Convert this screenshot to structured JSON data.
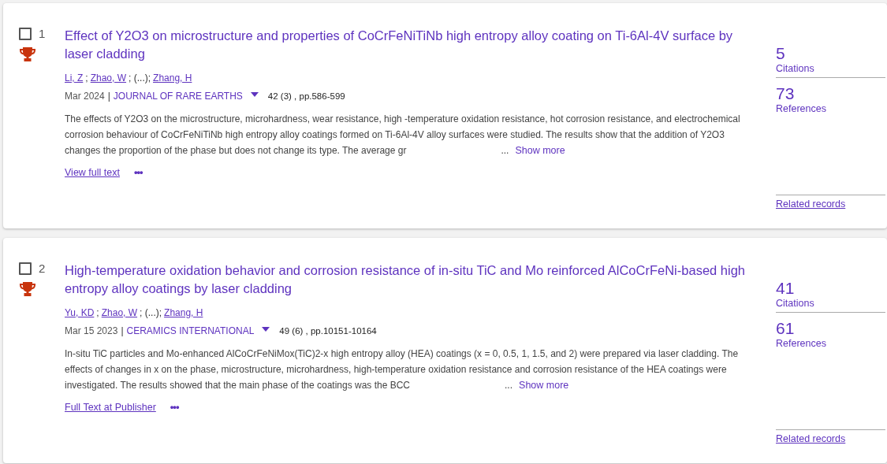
{
  "records": [
    {
      "number": "1",
      "checked": false,
      "title": "Effect of Y2O3 on microstructure and properties of CoCrFeNiTiNb high entropy alloy coating on Ti-6Al-4V surface by laser cladding",
      "authors": [
        {
          "text": "Li, Z",
          "kind": "link"
        },
        {
          "text": ";",
          "kind": "text"
        },
        {
          "text": "Zhao, W",
          "kind": "link"
        },
        {
          "text": "; (...);",
          "kind": "text"
        },
        {
          "text": "Zhang, H",
          "kind": "link"
        }
      ],
      "date": "Mar 2024",
      "separator": "|",
      "journal": "JOURNAL OF RARE EARTHS",
      "volume": "42 (3) , pp.586-599",
      "abstract": "The effects of Y2O3 on the microstructure, microhardness, wear resistance, high -temperature oxidation resistance, hot corrosion resistance, and electrochemical corrosion behaviour of CoCrFeNiTiNb high entropy alloy coatings formed on Ti-6Al-4V alloy surfaces were studied. The results show that the addition of Y2O3 changes the proportion of the phase but does not change its type. The average gr",
      "ellipsis": "...",
      "show_more": "Show more",
      "full_text": "View full text",
      "more": "•••",
      "citations": "5",
      "citations_label": "Citations",
      "references": "73",
      "references_label": "References",
      "related": "Related records"
    },
    {
      "number": "2",
      "checked": false,
      "title": "High-temperature oxidation behavior and corrosion resistance of in-situ TiC and Mo reinforced AlCoCrFeNi-based high entropy alloy coatings by laser cladding",
      "authors": [
        {
          "text": "Yu, KD",
          "kind": "link"
        },
        {
          "text": ";",
          "kind": "text"
        },
        {
          "text": "Zhao, W",
          "kind": "link"
        },
        {
          "text": "; (...);",
          "kind": "text"
        },
        {
          "text": "Zhang, H",
          "kind": "link"
        }
      ],
      "date": "Mar 15 2023",
      "separator": "|",
      "journal": "CERAMICS INTERNATIONAL",
      "volume": "49 (6) , pp.10151-10164",
      "abstract": "In-situ TiC particles and Mo-enhanced AlCoCrFeNiMox(TiC)2-x high entropy alloy (HEA) coatings (x = 0, 0.5, 1, 1.5, and 2) were prepared via laser cladding. The effects of changes in x on the phase, microstructure, microhardness, high-temperature oxidation resistance and corrosion resistance of the HEA coatings were investigated. The results showed that the main phase of the coatings was the BCC",
      "ellipsis": "...",
      "show_more": "Show more",
      "full_text": "Full Text at Publisher",
      "more": "•••",
      "citations": "41",
      "citations_label": "Citations",
      "references": "61",
      "references_label": "References",
      "related": "Related records"
    }
  ]
}
